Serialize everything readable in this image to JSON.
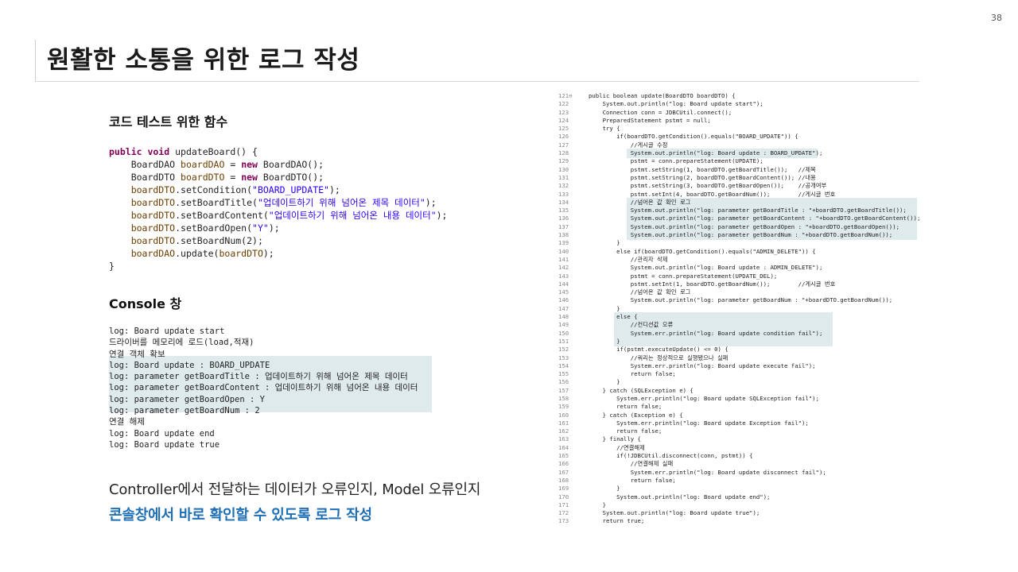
{
  "page_number": "38",
  "title": "원활한 소통을 위한 로그 작성",
  "test_section": {
    "heading": "코드 테스트 위한 함수",
    "code_lines": [
      [
        {
          "t": "kw",
          "v": "public void "
        },
        {
          "t": "",
          "v": "updateBoard() {"
        }
      ],
      [
        {
          "t": "",
          "v": "    BoardDAO "
        },
        {
          "t": "var",
          "v": "boardDAO"
        },
        {
          "t": "",
          "v": " = "
        },
        {
          "t": "kw",
          "v": "new"
        },
        {
          "t": "",
          "v": " BoardDAO();"
        }
      ],
      [
        {
          "t": "",
          "v": "    BoardDTO "
        },
        {
          "t": "var",
          "v": "boardDTO"
        },
        {
          "t": "",
          "v": " = "
        },
        {
          "t": "kw",
          "v": "new"
        },
        {
          "t": "",
          "v": " BoardDTO();"
        }
      ],
      [
        {
          "t": "var",
          "v": "    boardDTO"
        },
        {
          "t": "",
          "v": ".setCondition("
        },
        {
          "t": "str",
          "v": "\"BOARD_UPDATE\""
        },
        {
          "t": "",
          "v": ");"
        }
      ],
      [
        {
          "t": "var",
          "v": "    boardDTO"
        },
        {
          "t": "",
          "v": ".setBoardTitle("
        },
        {
          "t": "str",
          "v": "\"업데이트하기 위해 넘어온 제목 데이터\""
        },
        {
          "t": "",
          "v": ");"
        }
      ],
      [
        {
          "t": "var",
          "v": "    boardDTO"
        },
        {
          "t": "",
          "v": ".setBoardContent("
        },
        {
          "t": "str",
          "v": "\"업데이트하기 위해 넘어온 내용 데이터\""
        },
        {
          "t": "",
          "v": ");"
        }
      ],
      [
        {
          "t": "var",
          "v": "    boardDTO"
        },
        {
          "t": "",
          "v": ".setBoardOpen("
        },
        {
          "t": "str",
          "v": "\"Y\""
        },
        {
          "t": "",
          "v": ");"
        }
      ],
      [
        {
          "t": "var",
          "v": "    boardDTO"
        },
        {
          "t": "",
          "v": ".setBoardNum(2);"
        }
      ],
      [
        {
          "t": "var",
          "v": "    boardDAO"
        },
        {
          "t": "",
          "v": ".update("
        },
        {
          "t": "var",
          "v": "boardDTO"
        },
        {
          "t": "",
          "v": ");"
        }
      ],
      [
        {
          "t": "",
          "v": "}"
        }
      ]
    ]
  },
  "console_section": {
    "heading": "Console 창",
    "lines": [
      {
        "text": "log: Board update start",
        "hl": false
      },
      {
        "text": "드라이버를 메모리에 로드(load,적재)",
        "hl": false
      },
      {
        "text": "연결 객체 확보",
        "hl": false
      },
      {
        "text": "log: Board update : BOARD_UPDATE",
        "hl": true
      },
      {
        "text": "log: parameter getBoardTitle : 업데이트하기 위해 넘어온 제목 데이터",
        "hl": true
      },
      {
        "text": "log: parameter getBoardContent : 업데이트하기 위해 넘어온 내용 데이터",
        "hl": true
      },
      {
        "text": "log: parameter getBoardOpen : Y",
        "hl": true
      },
      {
        "text": "log: parameter getBoardNum : 2",
        "hl": true
      },
      {
        "text": "연결 해제",
        "hl": false
      },
      {
        "text": "log: Board update end",
        "hl": false
      },
      {
        "text": "log: Board update true",
        "hl": false
      }
    ]
  },
  "summary": {
    "line1": "Controller에서 전달하는 데이터가 오류인지, Model 오류인지",
    "line2": "콘솔창에서 바로 확인할 수 있도록 로그 작성"
  },
  "source_code": [
    {
      "n": "121⊖",
      "c": "public boolean update(BoardDTO boardDTO) {"
    },
    {
      "n": "122",
      "c": "    System.out.println(\"log: Board update start\");"
    },
    {
      "n": "123",
      "c": "    Connection conn = JDBCUtil.connect();"
    },
    {
      "n": "124",
      "c": "    PreparedStatement pstmt = null;"
    },
    {
      "n": "125",
      "c": "    try {"
    },
    {
      "n": "126",
      "c": "        if(boardDTO.getCondition().equals(\"BOARD_UPDATE\")) {"
    },
    {
      "n": "127",
      "c": "            //게시글 수정"
    },
    {
      "n": "128",
      "c": "            System.out.println(\"log: Board update : BOARD_UPDATE\");"
    },
    {
      "n": "129",
      "c": "            pstmt = conn.prepareStatement(UPDATE);"
    },
    {
      "n": "130",
      "c": "            pstmt.setString(1, boardDTO.getBoardTitle());   //제목"
    },
    {
      "n": "131",
      "c": "            pstmt.setString(2, boardDTO.getBoardContent()); //내용"
    },
    {
      "n": "132",
      "c": "            pstmt.setString(3, boardDTO.getBoardOpen());    //공개여부"
    },
    {
      "n": "133",
      "c": "            pstmt.setInt(4, boardDTO.getBoardNum());        //게시글 번호"
    },
    {
      "n": "134",
      "c": "            //넘어온 값 확인 로그"
    },
    {
      "n": "135",
      "c": "            System.out.println(\"log: parameter getBoardTitle : \"+boardDTO.getBoardTitle());"
    },
    {
      "n": "136",
      "c": "            System.out.println(\"log: parameter getBoardContent : \"+boardDTO.getBoardContent());"
    },
    {
      "n": "137",
      "c": "            System.out.println(\"log: parameter getBoardOpen : \"+boardDTO.getBoardOpen());"
    },
    {
      "n": "138",
      "c": "            System.out.println(\"log: parameter getBoardNum : \"+boardDTO.getBoardNum());"
    },
    {
      "n": "139",
      "c": "        }"
    },
    {
      "n": "140",
      "c": "        else if(boardDTO.getCondition().equals(\"ADMIN_DELETE\")) {"
    },
    {
      "n": "141",
      "c": "            //관리자 삭제"
    },
    {
      "n": "142",
      "c": "            System.out.println(\"log: Board update : ADMIN_DELETE\");"
    },
    {
      "n": "143",
      "c": "            pstmt = conn.prepareStatement(UPDATE_DEL);"
    },
    {
      "n": "144",
      "c": "            pstmt.setInt(1, boardDTO.getBoardNum());        //게시글 번호"
    },
    {
      "n": "145",
      "c": "            //넘어온 값 확인 로그"
    },
    {
      "n": "146",
      "c": "            System.out.println(\"log: parameter getBoardNum : \"+boardDTO.getBoardNum());"
    },
    {
      "n": "147",
      "c": "        }"
    },
    {
      "n": "148",
      "c": "        else {"
    },
    {
      "n": "149",
      "c": "            //컨디션값 오류"
    },
    {
      "n": "150",
      "c": "            System.err.println(\"log: Board update condition fail\");"
    },
    {
      "n": "151",
      "c": "        }"
    },
    {
      "n": "152",
      "c": "        if(pstmt.executeUpdate() <= 0) {"
    },
    {
      "n": "153",
      "c": "            //쿼리는 정상적으로 실행됐으나 실패"
    },
    {
      "n": "154",
      "c": "            System.err.println(\"log: Board update execute fail\");"
    },
    {
      "n": "155",
      "c": "            return false;"
    },
    {
      "n": "156",
      "c": "        }"
    },
    {
      "n": "157",
      "c": "    } catch (SQLException e) {"
    },
    {
      "n": "158",
      "c": "        System.err.println(\"log: Board update SQLException fail\");"
    },
    {
      "n": "159",
      "c": "        return false;"
    },
    {
      "n": "160",
      "c": "    } catch (Exception e) {"
    },
    {
      "n": "161",
      "c": "        System.err.println(\"log: Board update Exception fail\");"
    },
    {
      "n": "162",
      "c": "        return false;"
    },
    {
      "n": "163",
      "c": "    } finally {"
    },
    {
      "n": "164",
      "c": "        //연결해제"
    },
    {
      "n": "165",
      "c": "        if(!JDBCUtil.disconnect(conn, pstmt)) {"
    },
    {
      "n": "166",
      "c": "            //연결해제 실패"
    },
    {
      "n": "167",
      "c": "            System.err.println(\"log: Board update disconnect fail\");"
    },
    {
      "n": "168",
      "c": "            return false;"
    },
    {
      "n": "169",
      "c": "        }"
    },
    {
      "n": "170",
      "c": "        System.out.println(\"log: Board update end\");"
    },
    {
      "n": "171",
      "c": "    }"
    },
    {
      "n": "172",
      "c": "    System.out.println(\"log: Board update true\");"
    },
    {
      "n": "173",
      "c": "    return true;"
    }
  ]
}
